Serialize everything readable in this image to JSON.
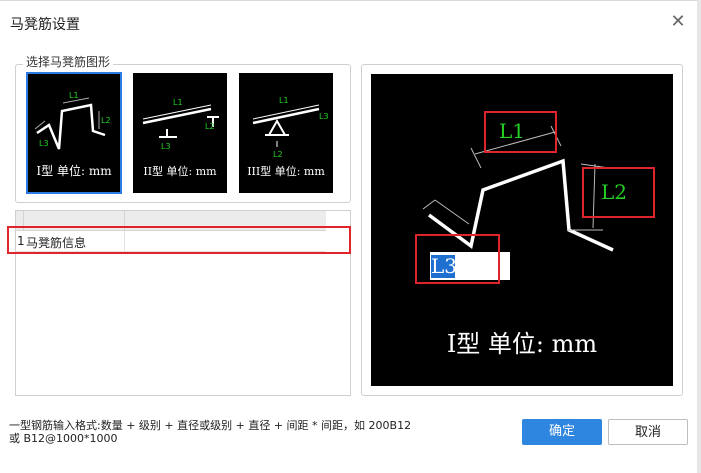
{
  "dialog": {
    "title": "马凳筋设置"
  },
  "shapes": {
    "legend": "选择马凳筋图形",
    "items": [
      {
        "caption": "I型 单位: mm",
        "labels": [
          "L1",
          "L2",
          "L3"
        ],
        "selected": true
      },
      {
        "caption": "II型 单位: mm",
        "labels": [
          "L1",
          "L2",
          "L3"
        ],
        "selected": false
      },
      {
        "caption": "III型 单位: mm",
        "labels": [
          "L1",
          "L2",
          "L3"
        ],
        "selected": false
      }
    ]
  },
  "table": {
    "rows": [
      {
        "index": "1",
        "name": "马凳筋信息",
        "value": ""
      }
    ]
  },
  "preview": {
    "labels": {
      "l1": "L1",
      "l2": "L2",
      "l3": "L3"
    },
    "caption": "I型 单位: mm"
  },
  "footer": {
    "hint_line1": "一型钢筋输入格式:数量 + 级别 + 直径或级别 + 直径 + 间距 * 间距，如 200B12",
    "hint_line2": "或 B12@1000*1000",
    "ok_label": "确定",
    "cancel_label": "取消"
  },
  "colors": {
    "accent": "#2f86e0",
    "highlight": "#e0242b",
    "label_green": "#23d023"
  }
}
